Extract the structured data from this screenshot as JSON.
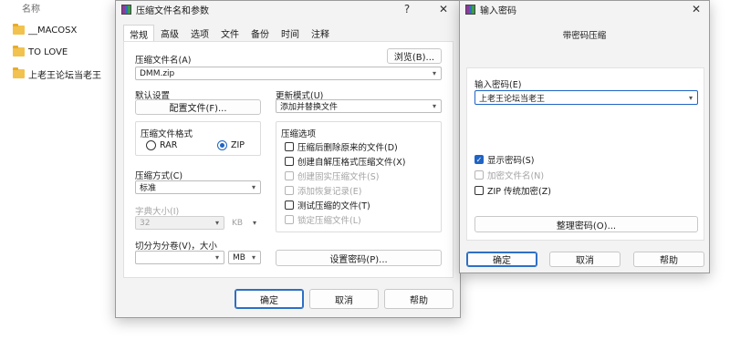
{
  "explorer": {
    "column_header": "名称",
    "items": [
      {
        "name": "__MACOSX"
      },
      {
        "name": "TO LOVE"
      },
      {
        "name": "上老王论坛当老王"
      }
    ]
  },
  "archive_dialog": {
    "title": "压缩文件名和参数",
    "help_glyph": "?",
    "close_glyph": "✕",
    "tabs": [
      "常规",
      "高级",
      "选项",
      "文件",
      "备份",
      "时间",
      "注释"
    ],
    "archive_name_label": "压缩文件名(A)",
    "browse_button": "浏览(B)...",
    "archive_name_value": "DMM.zip",
    "default_settings_label": "默认设置",
    "profiles_button": "配置文件(F)...",
    "update_mode_label": "更新模式(U)",
    "update_mode_value": "添加并替换文件",
    "format_group_label": "压缩文件格式",
    "format_rar": "RAR",
    "format_zip": "ZIP",
    "format_selected": "ZIP",
    "method_label": "压缩方式(C)",
    "method_value": "标准",
    "dict_size_label": "字典大小(I)",
    "dict_size_value": "32",
    "dict_size_unit": "KB",
    "split_label": "切分为分卷(V)，大小",
    "split_value": "",
    "split_unit": "MB",
    "options_group_label": "压缩选项",
    "options": [
      {
        "label": "压缩后删除原来的文件(D)",
        "checked": false,
        "disabled": false
      },
      {
        "label": "创建自解压格式压缩文件(X)",
        "checked": false,
        "disabled": false
      },
      {
        "label": "创建固实压缩文件(S)",
        "checked": false,
        "disabled": true
      },
      {
        "label": "添加恢复记录(E)",
        "checked": false,
        "disabled": true
      },
      {
        "label": "测试压缩的文件(T)",
        "checked": false,
        "disabled": false
      },
      {
        "label": "锁定压缩文件(L)",
        "checked": false,
        "disabled": true
      }
    ],
    "set_password_button": "设置密码(P)...",
    "ok_button": "确定",
    "cancel_button": "取消",
    "help_button": "帮助"
  },
  "password_dialog": {
    "title": "输入密码",
    "close_glyph": "✕",
    "heading": "带密码压缩",
    "enter_password_label": "输入密码(E)",
    "password_value": "上老王论坛当老王",
    "show_password_label": "显示密码(S)",
    "show_password_checked": true,
    "encrypt_names_label": "加密文件名(N)",
    "encrypt_names_disabled": true,
    "zip_legacy_label": "ZIP 传统加密(Z)",
    "organize_button": "整理密码(O)...",
    "ok_button": "确定",
    "cancel_button": "取消",
    "help_button": "帮助"
  }
}
